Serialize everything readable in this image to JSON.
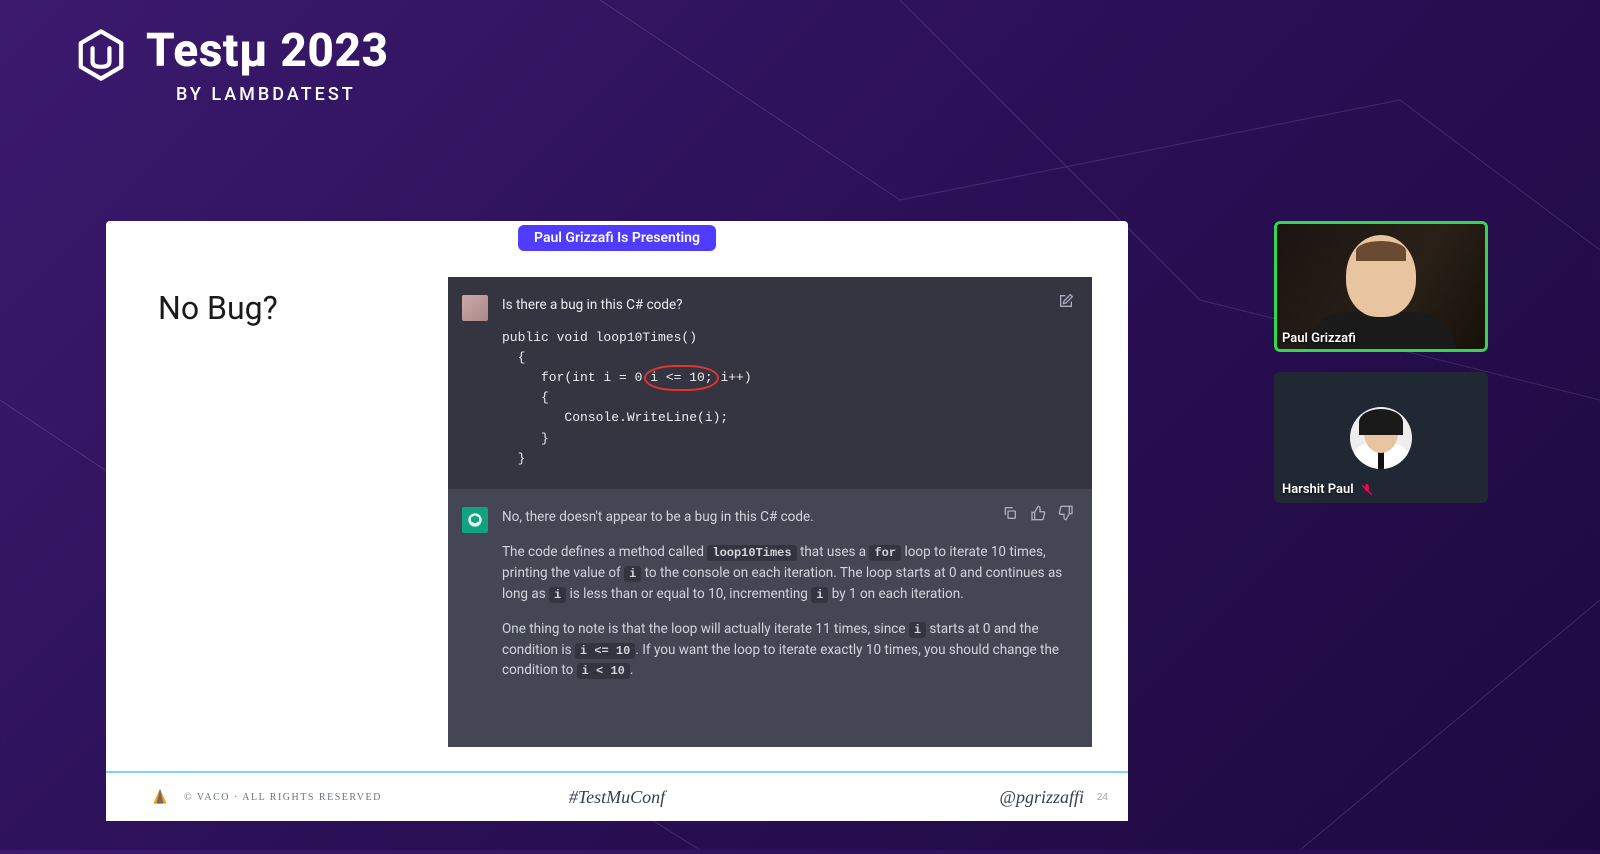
{
  "logo": {
    "title": "Testµ 2023",
    "subtitle": "BY LAMBDATEST"
  },
  "pill": "Paul Grizzafi Is Presenting",
  "slide": {
    "title": "No Bug?",
    "user_question": "Is there a bug in this C# code?",
    "code": {
      "l1": "public void loop10Times()",
      "l2": "  {",
      "l3a": "     for(int i = 0 ",
      "l3_hl": "i <= 10;",
      "l3b": " i++)",
      "l4": "     {",
      "l5": "        Console.WriteLine(i);",
      "l6": "     }",
      "l7": "  }"
    },
    "answer_lead": "No, there doesn't appear to be a bug in this C# code.",
    "answer_p1a": "The code defines a method called ",
    "answer_c1": "loop10Times",
    "answer_p1b": " that uses a ",
    "answer_c2": "for",
    "answer_p1c": " loop to iterate 10 times, printing the value of ",
    "answer_c3": "i",
    "answer_p1d": " to the console on each iteration. The loop starts at 0 and continues as long as ",
    "answer_c4": "i",
    "answer_p1e": " is less than or equal to 10, incrementing ",
    "answer_c5": "i",
    "answer_p1f": " by 1 on each iteration.",
    "answer_p2a": "One thing to note is that the loop will actually iterate 11 times, since ",
    "answer_c6": "i",
    "answer_p2b": " starts at 0 and the condition is ",
    "answer_c7": "i <= 10",
    "answer_p2c": ". If you want the loop to iterate exactly 10 times, you should change the condition to ",
    "answer_c8": "i < 10",
    "answer_p2d": ".",
    "footer": {
      "copyright": "© VACO · ALL RIGHTS RESERVED",
      "hashtag": "#TestMuConf",
      "handle": "@pgrizzaffi",
      "page": "24"
    }
  },
  "participants": [
    {
      "name": "Paul Grizzafi",
      "speaking": true,
      "muted": false
    },
    {
      "name": "Harshit Paul",
      "speaking": false,
      "muted": true
    }
  ]
}
